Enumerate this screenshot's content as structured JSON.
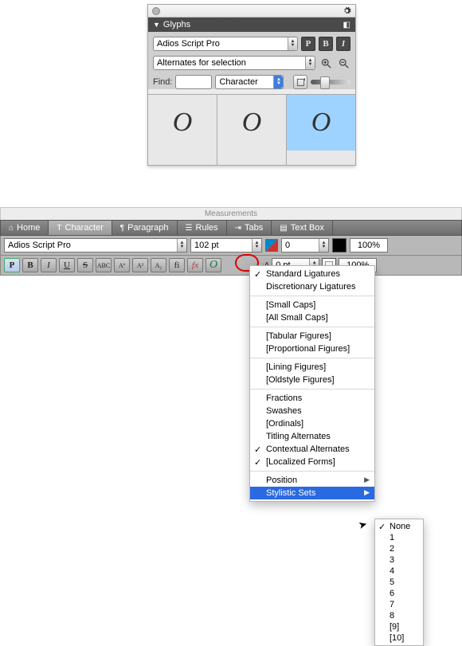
{
  "glyphs_panel": {
    "title": "Glyphs",
    "font_name": "Adios Script Pro",
    "subset": "Alternates for selection",
    "find_label": "Find:",
    "find_value": "",
    "mode": "Character",
    "style_buttons": {
      "p": "P",
      "b": "B",
      "i": "I"
    },
    "cells": [
      "O",
      "O",
      "O"
    ],
    "selected_cell_index": 2
  },
  "measurements": {
    "strip_title": "Measurements",
    "tabs": [
      {
        "icon": "home-icon",
        "label": "Home"
      },
      {
        "icon": "type-icon",
        "label": "Character"
      },
      {
        "icon": "para-icon",
        "label": "Paragraph"
      },
      {
        "icon": "rules-icon",
        "label": "Rules"
      },
      {
        "icon": "tabs-icon",
        "label": "Tabs"
      },
      {
        "icon": "textbox-icon",
        "label": "Text Box"
      }
    ],
    "active_tab_index": 1,
    "font_name": "Adios Script Pro",
    "font_size": "102 pt",
    "tracking": "0",
    "baseline": "0 pt",
    "color_percent": "100%",
    "shade_percent": "100%",
    "type_tools": {
      "p": "P",
      "b": "B",
      "i": "I",
      "u": "U",
      "s": "S",
      "abc": "ABC",
      "Aa1": "Aª",
      "a2": "A²",
      "a2b": "A₂",
      "fi": "fi",
      "fx": "fx",
      "glyph": "O"
    }
  },
  "ot_menu": {
    "items": [
      {
        "label": "Standard Ligatures",
        "checked": true
      },
      {
        "label": "Discretionary Ligatures"
      },
      {
        "sep": true
      },
      {
        "label": "[Small Caps]"
      },
      {
        "label": "[All Small Caps]"
      },
      {
        "sep": true
      },
      {
        "label": "[Tabular Figures]"
      },
      {
        "label": "[Proportional Figures]"
      },
      {
        "sep": true
      },
      {
        "label": "[Lining Figures]"
      },
      {
        "label": "[Oldstyle Figures]"
      },
      {
        "sep": true
      },
      {
        "label": "Fractions"
      },
      {
        "label": "Swashes"
      },
      {
        "label": "[Ordinals]"
      },
      {
        "label": "Titling Alternates"
      },
      {
        "label": "Contextual Alternates",
        "checked": true
      },
      {
        "label": "[Localized Forms]",
        "checked": true
      },
      {
        "sep": true
      },
      {
        "label": "Position",
        "submenu": true
      },
      {
        "label": "Stylistic Sets",
        "submenu": true,
        "highlight": true
      }
    ]
  },
  "stylistic_submenu": {
    "items": [
      {
        "label": "None",
        "checked": true
      },
      {
        "label": "1"
      },
      {
        "label": "2"
      },
      {
        "label": "3"
      },
      {
        "label": "4"
      },
      {
        "label": "5"
      },
      {
        "label": "6"
      },
      {
        "label": "7"
      },
      {
        "label": "8"
      },
      {
        "label": "[9]"
      },
      {
        "label": "[10]"
      }
    ]
  }
}
